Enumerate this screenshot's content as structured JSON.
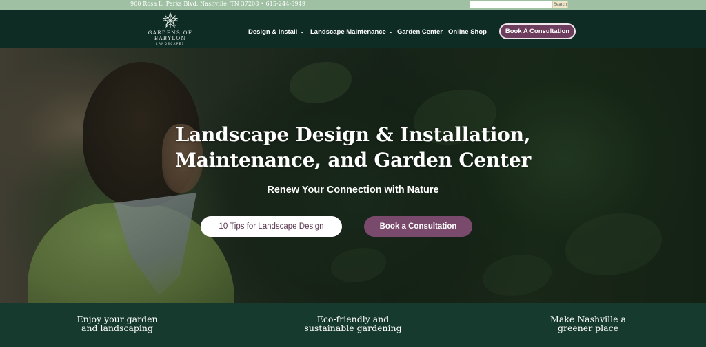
{
  "topbar": {
    "address": "900 Rosa L. Parks Blvd. Nashville, TN 37208 • 615-244-8949",
    "search_placeholder": "",
    "search_button": "Search"
  },
  "logo": {
    "main": "GARDENS OF BABYLON",
    "sub": "LANDSCAPES"
  },
  "nav": {
    "items": [
      {
        "label": "Design & Install",
        "has_dropdown": true
      },
      {
        "label": "Landscape Maintenance",
        "has_dropdown": true
      },
      {
        "label": "Garden Center",
        "has_dropdown": false
      },
      {
        "label": "Online Shop",
        "has_dropdown": false
      }
    ],
    "cta": "Book A Consultation"
  },
  "hero": {
    "title_line1": "Landscape Design & Installation,",
    "title_line2": "Maintenance, and Garden Center",
    "subtitle": "Renew Your Connection with Nature",
    "button_primary": "10 Tips for Landscape Design",
    "button_secondary": "Book a Consultation"
  },
  "features": [
    {
      "line1": "Enjoy your garden",
      "line2": "and landscaping"
    },
    {
      "line1": "Eco-friendly and",
      "line2": "sustainable gardening"
    },
    {
      "line1": "Make Nashville a",
      "line2": "greener place"
    }
  ],
  "icons": {
    "logo": "star-flower-icon",
    "dropdown": "chevron-down-icon"
  },
  "colors": {
    "topbar": "#9fc0a3",
    "header": "#0f2c24",
    "accent_plum": "#7a4a6c",
    "features": "#163a2e"
  }
}
